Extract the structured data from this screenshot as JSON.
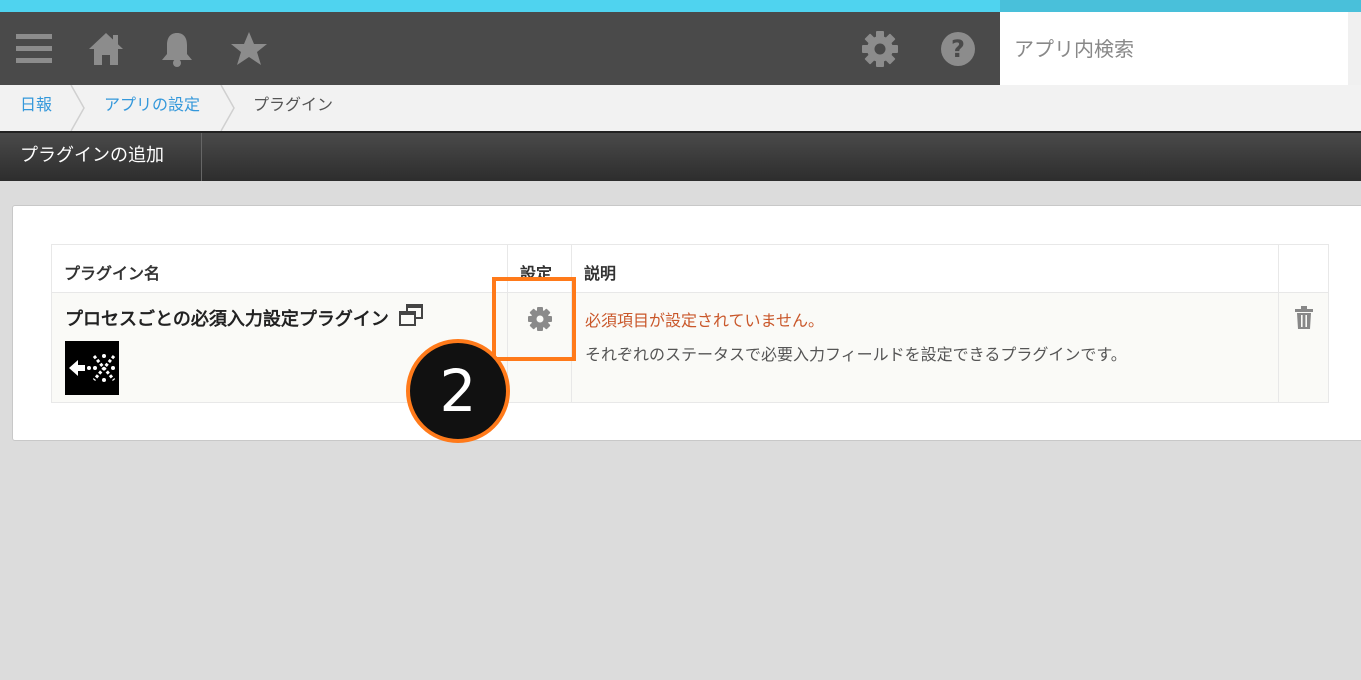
{
  "header": {
    "search_placeholder": "アプリ内検索",
    "icons": [
      "menu-icon",
      "home-icon",
      "bell-icon",
      "star-icon",
      "gear-icon",
      "help-icon"
    ]
  },
  "breadcrumb": {
    "items": [
      "日報",
      "アプリの設定",
      "プラグイン"
    ]
  },
  "toolbar": {
    "add_plugin_label": "プラグインの追加"
  },
  "table": {
    "headers": {
      "name": "プラグイン名",
      "settings": "設定",
      "description": "説明"
    },
    "rows": [
      {
        "name": "プロセスごとの必須入力設定プラグイン",
        "warning": "必須項目が設定されていません。",
        "description": "それぞれのステータスで必要入力フィールドを設定できるプラグインです。"
      }
    ]
  },
  "annotation": {
    "step_number": "2"
  },
  "colors": {
    "accent_stripe": "#4fd3ef",
    "header_bg": "#4a4a4a",
    "link": "#3498db",
    "warning": "#c9572a",
    "highlight": "#ff7a1a"
  }
}
